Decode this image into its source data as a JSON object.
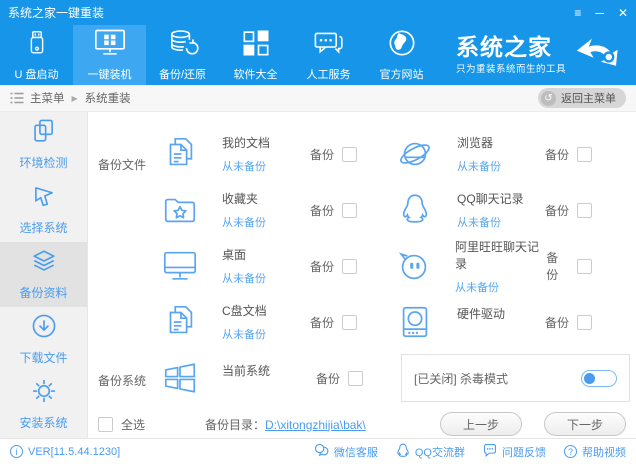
{
  "window": {
    "title": "系统之家一键重装"
  },
  "icons": {
    "menu": "≡",
    "minimize": "─",
    "close": "✕",
    "back": "↺",
    "breadcrumb_arrow": "▶",
    "info": "i",
    "help": "?"
  },
  "nav": {
    "items": [
      {
        "label": "U 盘启动",
        "icon": "usb-icon"
      },
      {
        "label": "一键装机",
        "icon": "monitor-install-icon",
        "selected": true
      },
      {
        "label": "备份/还原",
        "icon": "database-restore-icon"
      },
      {
        "label": "软件大全",
        "icon": "apps-icon"
      },
      {
        "label": "人工服务",
        "icon": "chat-service-icon"
      },
      {
        "label": "官方网站",
        "icon": "globe-icon"
      }
    ],
    "logo": {
      "title": "系统之家",
      "tagline": "只为重装系统而生的工具"
    }
  },
  "breadcrumb": {
    "root": "主菜单",
    "current": "系统重装",
    "back_button": "返回主菜单"
  },
  "sidebar": {
    "items": [
      {
        "label": "环境检测",
        "icon": "env-check-icon"
      },
      {
        "label": "选择系统",
        "icon": "cursor-icon"
      },
      {
        "label": "备份资料",
        "icon": "layers-icon",
        "selected": true
      },
      {
        "label": "下载文件",
        "icon": "download-icon"
      },
      {
        "label": "安装系统",
        "icon": "gear-icon"
      }
    ]
  },
  "main": {
    "backup_label": "备份",
    "backup_files": {
      "section_label": "备份文件",
      "items": [
        {
          "title": "我的文档",
          "status": "从未备份",
          "icon": "documents-icon"
        },
        {
          "title": "浏览器",
          "status": "从未备份",
          "icon": "browser-icon"
        },
        {
          "title": "收藏夹",
          "status": "从未备份",
          "icon": "favorites-folder-icon"
        },
        {
          "title": "QQ聊天记录",
          "status": "从未备份",
          "icon": "qq-icon"
        },
        {
          "title": "桌面",
          "status": "从未备份",
          "icon": "desktop-icon"
        },
        {
          "title": "阿里旺旺聊天记录",
          "status": "从未备份",
          "icon": "aliwangwang-icon"
        },
        {
          "title": "C盘文档",
          "status": "从未备份",
          "icon": "documents-icon"
        },
        {
          "title": "硬件驱动",
          "status": "",
          "icon": "hardware-drive-icon"
        }
      ]
    },
    "backup_system": {
      "section_label": "备份系统",
      "item_title": "当前系统",
      "antivirus_label": "[已关闭] 杀毒模式",
      "toggle_state": "off"
    },
    "bottom": {
      "select_all": "全选",
      "backup_dir_label": "备份目录：",
      "backup_dir_value": "D:\\xitongzhijia\\bak\\",
      "prev_button": "上一步",
      "next_button": "下一步"
    }
  },
  "footer": {
    "version": "VER[11.5.44.1230]",
    "links": [
      {
        "label": "微信客服",
        "icon": "wechat-icon"
      },
      {
        "label": "QQ交流群",
        "icon": "qq-icon"
      },
      {
        "label": "问题反馈",
        "icon": "feedback-icon"
      },
      {
        "label": "帮助视频",
        "icon": "help-icon"
      }
    ]
  },
  "colors": {
    "primary_blue": "#1796e9",
    "selected_tab": "#3da8f1",
    "accent_blue": "#4a9cee",
    "status_link_blue": "#58a7f0"
  }
}
